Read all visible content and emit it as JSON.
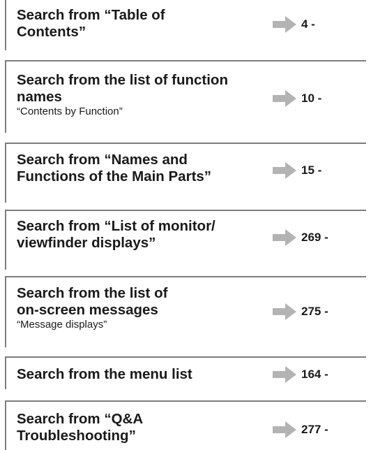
{
  "entries": [
    {
      "title_lines": [
        "Search from “Table of",
        "Contents”"
      ],
      "subtitle": "",
      "page": "4 -"
    },
    {
      "title_lines": [
        "Search from the list of function",
        "names"
      ],
      "subtitle": "“Contents by Function”",
      "page": "10 -"
    },
    {
      "title_lines": [
        "Search from “Names and",
        "Functions of the Main Parts”"
      ],
      "subtitle": "",
      "page": "15 -"
    },
    {
      "title_lines": [
        "Search from “List of monitor/",
        "viewfinder displays”"
      ],
      "subtitle": "",
      "page": "269 -"
    },
    {
      "title_lines": [
        "Search from the list of",
        "on-screen messages"
      ],
      "subtitle": "“Message displays”",
      "page": "275 -"
    },
    {
      "title_lines": [
        "Search from the menu list"
      ],
      "subtitle": "",
      "page": "164 -"
    },
    {
      "title_lines": [
        "Search from “Q&A",
        "Troubleshooting”"
      ],
      "subtitle": "",
      "page": "277 -"
    }
  ],
  "colors": {
    "rule": "#7d7d7d",
    "arrow": "#b3b3b3",
    "text": "#1a1a1a"
  },
  "icons": {
    "page_pointer": "arrow-right-icon"
  }
}
